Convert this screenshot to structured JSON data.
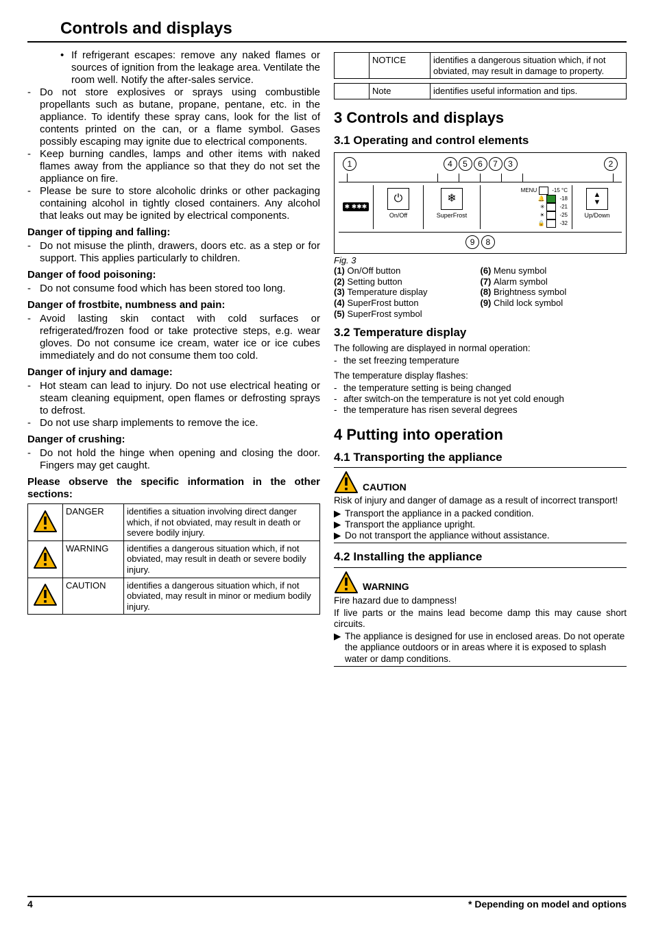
{
  "page_title": "Controls and displays",
  "left": {
    "bullet": "If refrigerant escapes: remove any naked flames or sources of ignition from the leakage area. Ventilate the room well. Notify the after-sales service.",
    "dashes": [
      "Do not store explosives or sprays using combustible propellants such as butane, propane, pentane, etc. in the appliance. To identify these spray cans, look for the list of contents printed on the can, or a flame symbol. Gases possibly escaping may ignite due to electrical components.",
      "Keep burning candles, lamps and other items with naked flames away from the appliance so that they do not set the appliance on fire.",
      "Please be sure to store alcoholic drinks or other packaging containing alcohol in tightly closed containers. Any alcohol that leaks out may be ignited by electrical components."
    ],
    "d_tipping_h": "Danger of tipping and falling:",
    "d_tipping": "Do not misuse the plinth, drawers, doors etc. as a step or for support. This applies particularly to children.",
    "d_food_h": "Danger of food poisoning:",
    "d_food": "Do not consume food which has been stored too long.",
    "d_frost_h": "Danger of frostbite, numbness and pain:",
    "d_frost": "Avoid lasting skin contact with cold surfaces or refrigerated/frozen food or take protective steps, e.g. wear gloves. Do not consume ice cream, water ice or ice cubes immediately and do not consume them too cold.",
    "d_injury_h": "Danger of injury and damage:",
    "d_injury": [
      "Hot steam can lead to injury. Do not use electrical heating or steam cleaning equipment, open flames or defrosting sprays to defrost.",
      "Do not use sharp implements to remove the ice."
    ],
    "d_crush_h": "Danger of crushing:",
    "d_crush": "Do not hold the hinge when opening and closing the door. Fingers may get caught.",
    "observe": "Please observe the specific information in the other sections:",
    "hazard_rows": [
      {
        "label": "DANGER",
        "desc": "identifies a situation involving direct danger which, if not obviated, may result in death or severe bodily injury."
      },
      {
        "label": "WARNING",
        "desc": "identifies a dangerous situation which, if not obviated, may result in death or severe bodily injury."
      },
      {
        "label": "CAUTION",
        "desc": "identifies a dangerous situation which, if not obviated, may result in minor or medium bodily injury."
      }
    ]
  },
  "right": {
    "hazard_rows": [
      {
        "label": "NOTICE",
        "desc": "identifies a dangerous situation which, if not obviated, may result in damage to property."
      },
      {
        "label": "Note",
        "desc": "identifies useful information and tips."
      }
    ],
    "s3": "3 Controls and displays",
    "s31": "3.1 Operating and control elements",
    "fig_caption": "Fig. 3",
    "legend_left": [
      "(1) On/Off button",
      "(2) Setting button",
      "(3) Temperature display",
      "(4) SuperFrost button",
      "(5) SuperFrost symbol"
    ],
    "legend_right": [
      "(6) Menu symbol",
      "(7) Alarm symbol",
      "(8) Brightness symbol",
      "(9) Child lock symbol"
    ],
    "s32": "3.2 Temperature display",
    "s32_intro": "The following are displayed in normal operation:",
    "s32_list1": [
      "the set freezing temperature"
    ],
    "s32_mid": "The temperature display flashes:",
    "s32_list2": [
      "the temperature setting is being changed",
      "after switch-on the temperature is not yet cold enough",
      "the temperature has risen several degrees"
    ],
    "s4": "4 Putting into operation",
    "s41": "4.1 Transporting the appliance",
    "caution_label": "CAUTION",
    "s41_intro": "Risk of injury and danger of damage as a result of incorrect transport!",
    "s41_list": [
      "Transport the appliance in a packed condition.",
      "Transport the appliance upright.",
      "Do not transport the appliance without assistance."
    ],
    "s42": "4.2 Installing the appliance",
    "warning_label": "WARNING",
    "s42_intro": "Fire hazard due to dampness!",
    "s42_body": "If live parts or the mains lead become damp this may cause short circuits.",
    "s42_list": [
      "The appliance is designed for use in enclosed areas. Do not operate the appliance outdoors or in areas where it is exposed to splash water or damp conditions."
    ],
    "panel_labels": {
      "onoff": "On/Off",
      "superfrost": "SuperFrost",
      "updown": "Up/Down",
      "menu": "MENU",
      "temps": [
        "-15 °C",
        "-18",
        "-21",
        "-25",
        "-32"
      ]
    }
  },
  "footer": {
    "left": "4",
    "right": "* Depending on model and options"
  }
}
